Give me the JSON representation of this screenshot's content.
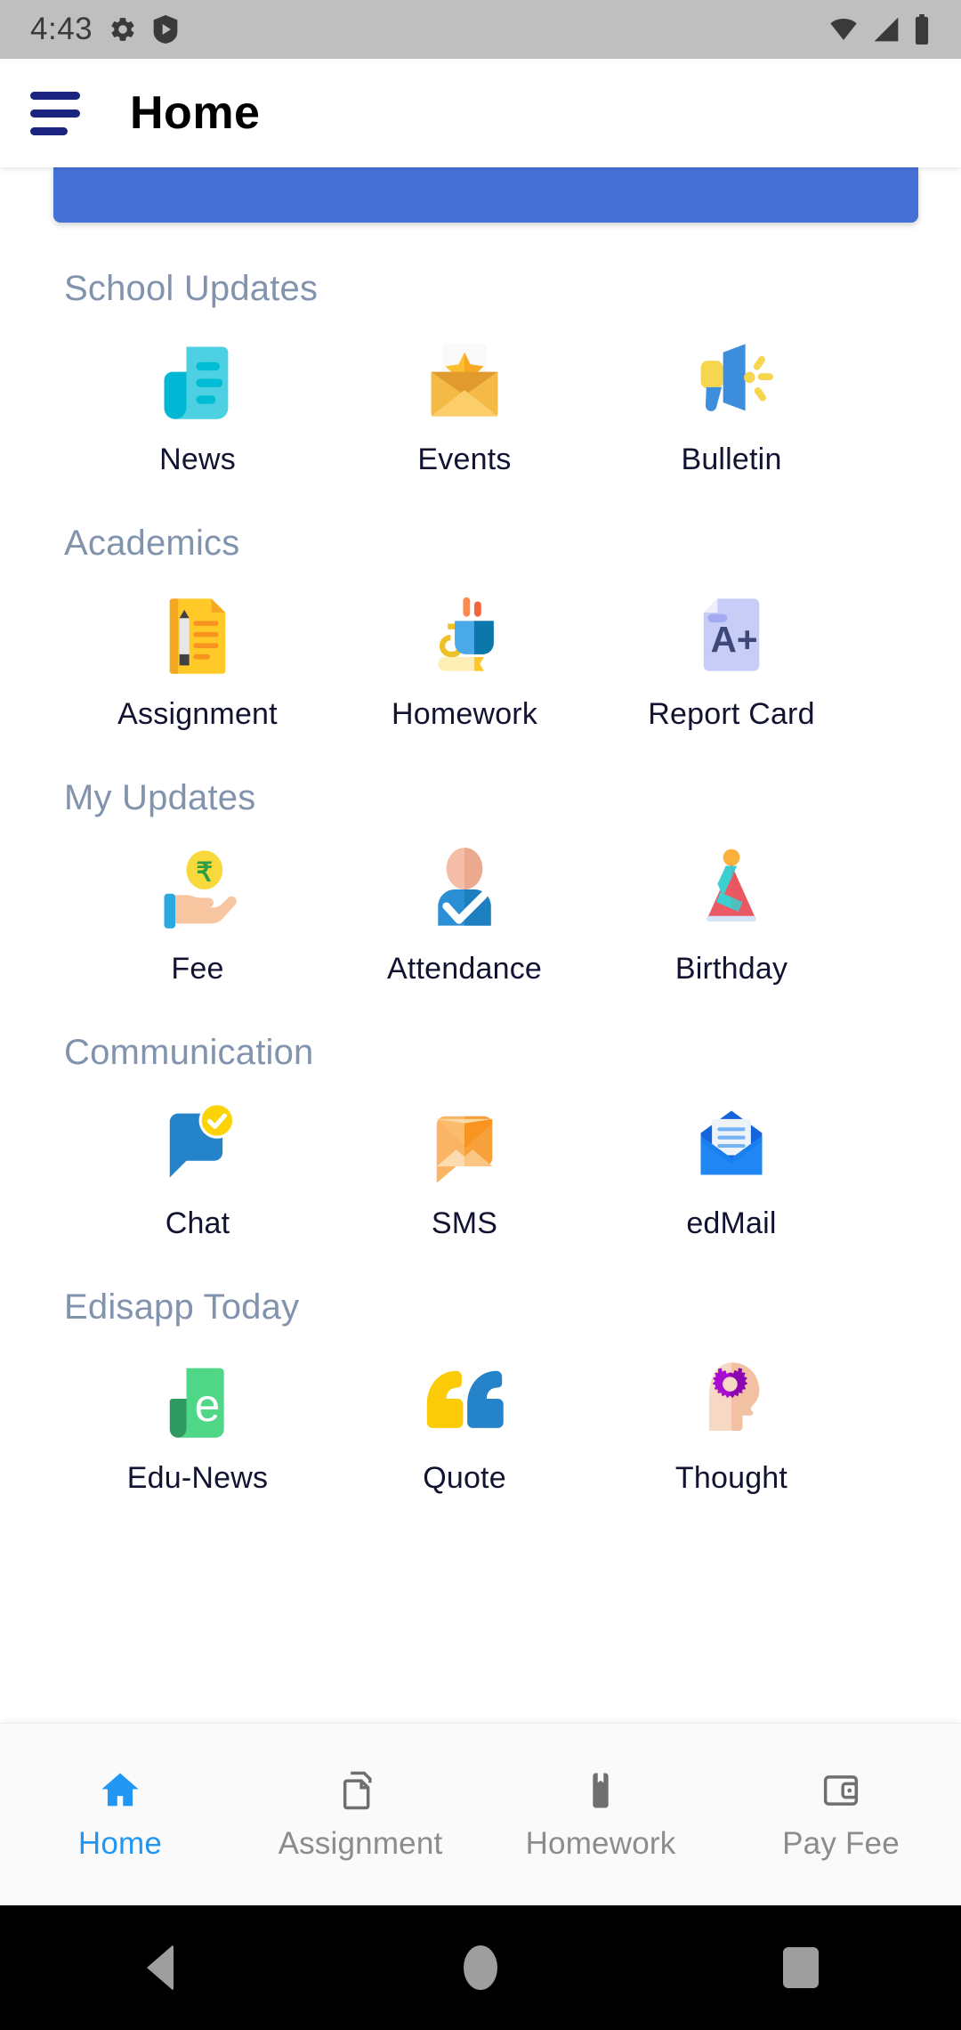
{
  "status_bar": {
    "time": "4:43",
    "left_icons": [
      "gear-icon",
      "play-store-icon"
    ],
    "right_icons": [
      "wifi-icon",
      "signal-icon",
      "battery-icon"
    ]
  },
  "app_bar": {
    "menu_icon": "hamburger-menu-icon",
    "title": "Home"
  },
  "banner": {
    "color": "#4571d6"
  },
  "colors": {
    "section_title": "#8193ad",
    "tile_label": "#121331",
    "accent": "#2196f3",
    "nav_inactive": "#8c8c8c",
    "banner": "#4571d6"
  },
  "sections": [
    {
      "title": "School Updates",
      "tiles": [
        {
          "label": "News",
          "icon": "news-icon"
        },
        {
          "label": "Events",
          "icon": "events-icon"
        },
        {
          "label": "Bulletin",
          "icon": "bulletin-icon"
        }
      ]
    },
    {
      "title": "Academics",
      "tiles": [
        {
          "label": "Assignment",
          "icon": "assignment-icon"
        },
        {
          "label": "Homework",
          "icon": "homework-icon"
        },
        {
          "label": "Report Card",
          "icon": "report-card-icon"
        }
      ]
    },
    {
      "title": "My Updates",
      "tiles": [
        {
          "label": "Fee",
          "icon": "fee-icon"
        },
        {
          "label": "Attendance",
          "icon": "attendance-icon"
        },
        {
          "label": "Birthday",
          "icon": "birthday-icon"
        }
      ]
    },
    {
      "title": "Communication",
      "tiles": [
        {
          "label": "Chat",
          "icon": "chat-icon"
        },
        {
          "label": "SMS",
          "icon": "sms-icon"
        },
        {
          "label": "edMail",
          "icon": "edmail-icon"
        }
      ]
    },
    {
      "title": "Edisapp Today",
      "tiles": [
        {
          "label": "Edu-News",
          "icon": "edu-news-icon"
        },
        {
          "label": "Quote",
          "icon": "quote-icon"
        },
        {
          "label": "Thought",
          "icon": "thought-icon"
        }
      ]
    }
  ],
  "bottom_nav": {
    "items": [
      {
        "label": "Home",
        "icon": "home-icon",
        "active": true
      },
      {
        "label": "Assignment",
        "icon": "copy-pages-icon",
        "active": false
      },
      {
        "label": "Homework",
        "icon": "bookmark-icon",
        "active": false
      },
      {
        "label": "Pay Fee",
        "icon": "wallet-card-icon",
        "active": false
      }
    ]
  },
  "android_nav": {
    "back": "back-triangle-icon",
    "home": "home-circle-icon",
    "recents": "recents-square-icon"
  }
}
